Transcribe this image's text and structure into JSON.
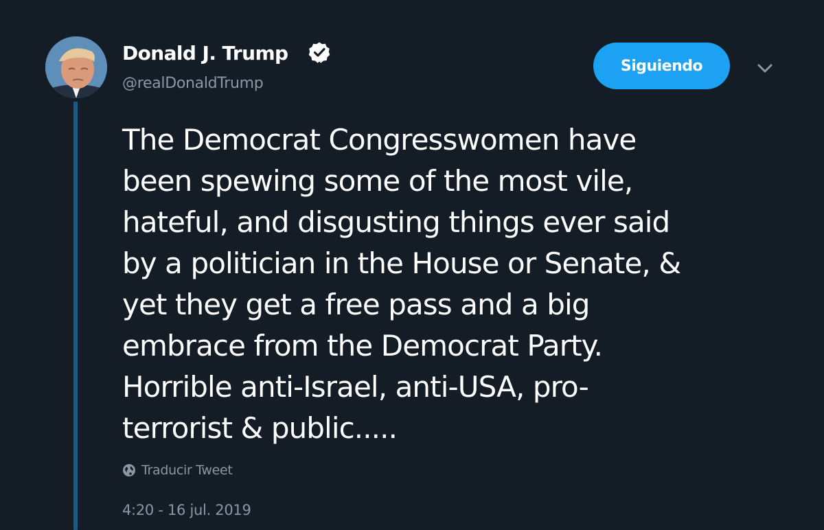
{
  "author": {
    "name": "Donald J. Trump",
    "handle": "@realDonaldTrump",
    "verified": true
  },
  "follow_button": {
    "label": "Siguiendo"
  },
  "tweet": {
    "text": "The Democrat Congresswomen have\nbeen spewing some of the most vile,\nhateful, and disgusting things ever said\nby a politician in the House or Senate, &\nyet they get a free pass and a big\nembrace from the Democrat Party.\nHorrible anti-Israel, anti-USA, pro-\nterrorist & public.....",
    "translate_label": "Traducir Tweet",
    "timestamp": "4:20 - 16 jul. 2019"
  },
  "icons": {
    "verified": "verified-badge-icon",
    "more": "chevron-down-icon",
    "translate": "globe-icon"
  },
  "colors": {
    "background": "#141d26",
    "accent": "#1da1f2",
    "secondary_text": "#8899a6",
    "thread_line": "#1c5a86"
  }
}
